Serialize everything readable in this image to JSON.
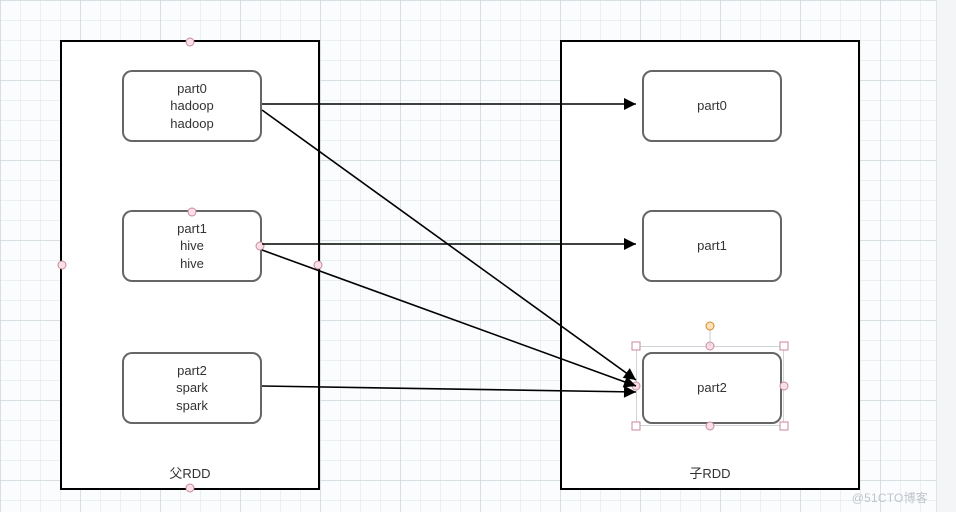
{
  "parent": {
    "label": "父RDD",
    "partitions": [
      {
        "name": "part0",
        "lines": [
          "part0",
          "hadoop",
          "hadoop"
        ]
      },
      {
        "name": "part1",
        "lines": [
          "part1",
          "hive",
          "hive"
        ]
      },
      {
        "name": "part2",
        "lines": [
          "part2",
          "spark",
          "spark"
        ]
      }
    ]
  },
  "child": {
    "label": "子RDD",
    "partitions": [
      {
        "name": "part0",
        "label": "part0"
      },
      {
        "name": "part1",
        "label": "part1"
      },
      {
        "name": "part2",
        "label": "part2",
        "selected": true
      }
    ]
  },
  "edges": [
    {
      "from": "parent.part0",
      "to": "child.part0"
    },
    {
      "from": "parent.part0",
      "to": "child.part2"
    },
    {
      "from": "parent.part1",
      "to": "child.part1"
    },
    {
      "from": "parent.part1",
      "to": "child.part2"
    },
    {
      "from": "parent.part2",
      "to": "child.part2"
    }
  ],
  "watermark": "@51CTO博客",
  "chart_data": {
    "type": "diagram",
    "title": "",
    "nodes": [
      {
        "id": "parent",
        "label": "父RDD",
        "type": "container"
      },
      {
        "id": "parent.part0",
        "label": "part0",
        "content": [
          "hadoop",
          "hadoop"
        ],
        "parent": "parent"
      },
      {
        "id": "parent.part1",
        "label": "part1",
        "content": [
          "hive",
          "hive"
        ],
        "parent": "parent"
      },
      {
        "id": "parent.part2",
        "label": "part2",
        "content": [
          "spark",
          "spark"
        ],
        "parent": "parent"
      },
      {
        "id": "child",
        "label": "子RDD",
        "type": "container"
      },
      {
        "id": "child.part0",
        "label": "part0",
        "parent": "child"
      },
      {
        "id": "child.part1",
        "label": "part1",
        "parent": "child"
      },
      {
        "id": "child.part2",
        "label": "part2",
        "parent": "child",
        "selected": true
      }
    ],
    "edges": [
      {
        "from": "parent.part0",
        "to": "child.part0"
      },
      {
        "from": "parent.part0",
        "to": "child.part2"
      },
      {
        "from": "parent.part1",
        "to": "child.part1"
      },
      {
        "from": "parent.part1",
        "to": "child.part2"
      },
      {
        "from": "parent.part2",
        "to": "child.part2"
      }
    ]
  }
}
